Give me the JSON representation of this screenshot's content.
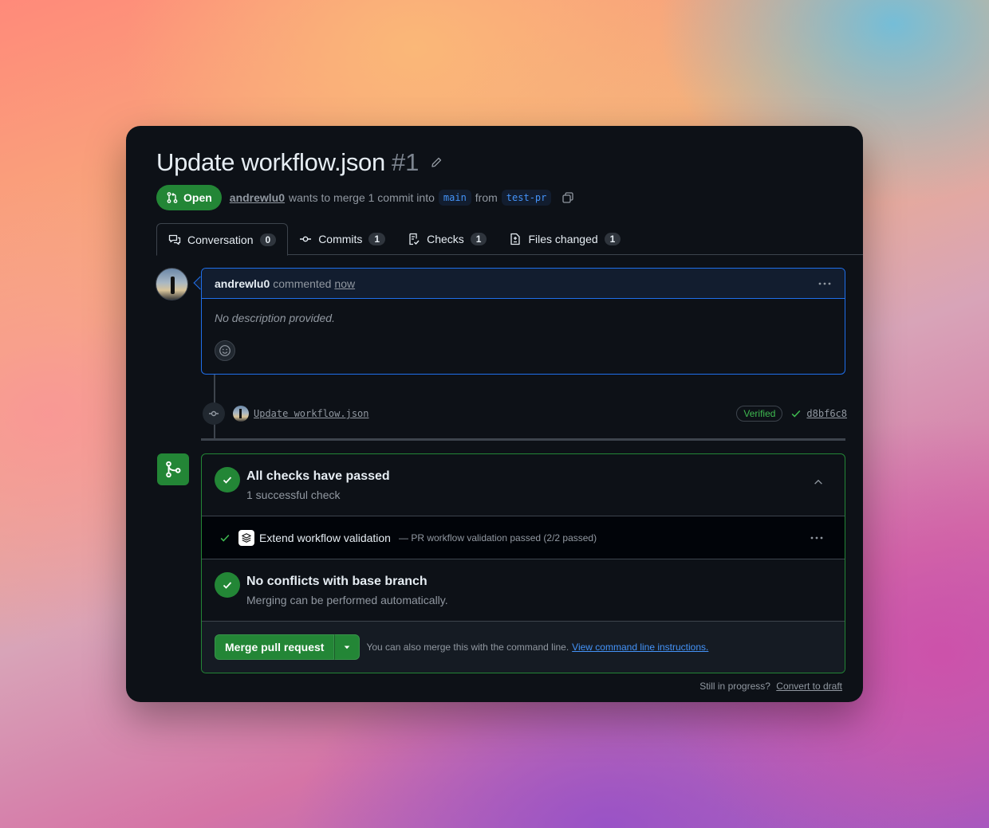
{
  "pr": {
    "title": "Update workflow.json",
    "number": "#1",
    "state": "Open",
    "author": "andrewlu0",
    "merge_text": "wants to merge 1 commit into",
    "base_branch": "main",
    "from_text": "from",
    "head_branch": "test-pr"
  },
  "tabs": [
    {
      "label": "Conversation",
      "count": "0",
      "icon": "comment-discussion-icon",
      "active": true
    },
    {
      "label": "Commits",
      "count": "1",
      "icon": "git-commit-icon"
    },
    {
      "label": "Checks",
      "count": "1",
      "icon": "checklist-icon"
    },
    {
      "label": "Files changed",
      "count": "1",
      "icon": "file-diff-icon"
    }
  ],
  "comment": {
    "author": "andrewlu0",
    "action": "commented",
    "time": "now",
    "body": "No description provided."
  },
  "commit": {
    "message": "Update workflow.json",
    "verified": "Verified",
    "sha": "d8bf6c8"
  },
  "checks": {
    "title": "All checks have passed",
    "subtitle": "1 successful check",
    "items": [
      {
        "name": "Extend workflow validation",
        "description": "— PR workflow validation passed (2/2 passed)"
      }
    ]
  },
  "conflicts": {
    "title": "No conflicts with base branch",
    "subtitle": "Merging can be performed automatically."
  },
  "merge": {
    "button_label": "Merge pull request",
    "cli_text": "You can also merge this with the command line.",
    "cli_link": "View command line instructions."
  },
  "draft": {
    "prompt": "Still in progress?",
    "link": "Convert to draft"
  },
  "colors": {
    "accent_green": "#238636",
    "link_blue": "#4493f8",
    "bg": "#0d1117"
  }
}
